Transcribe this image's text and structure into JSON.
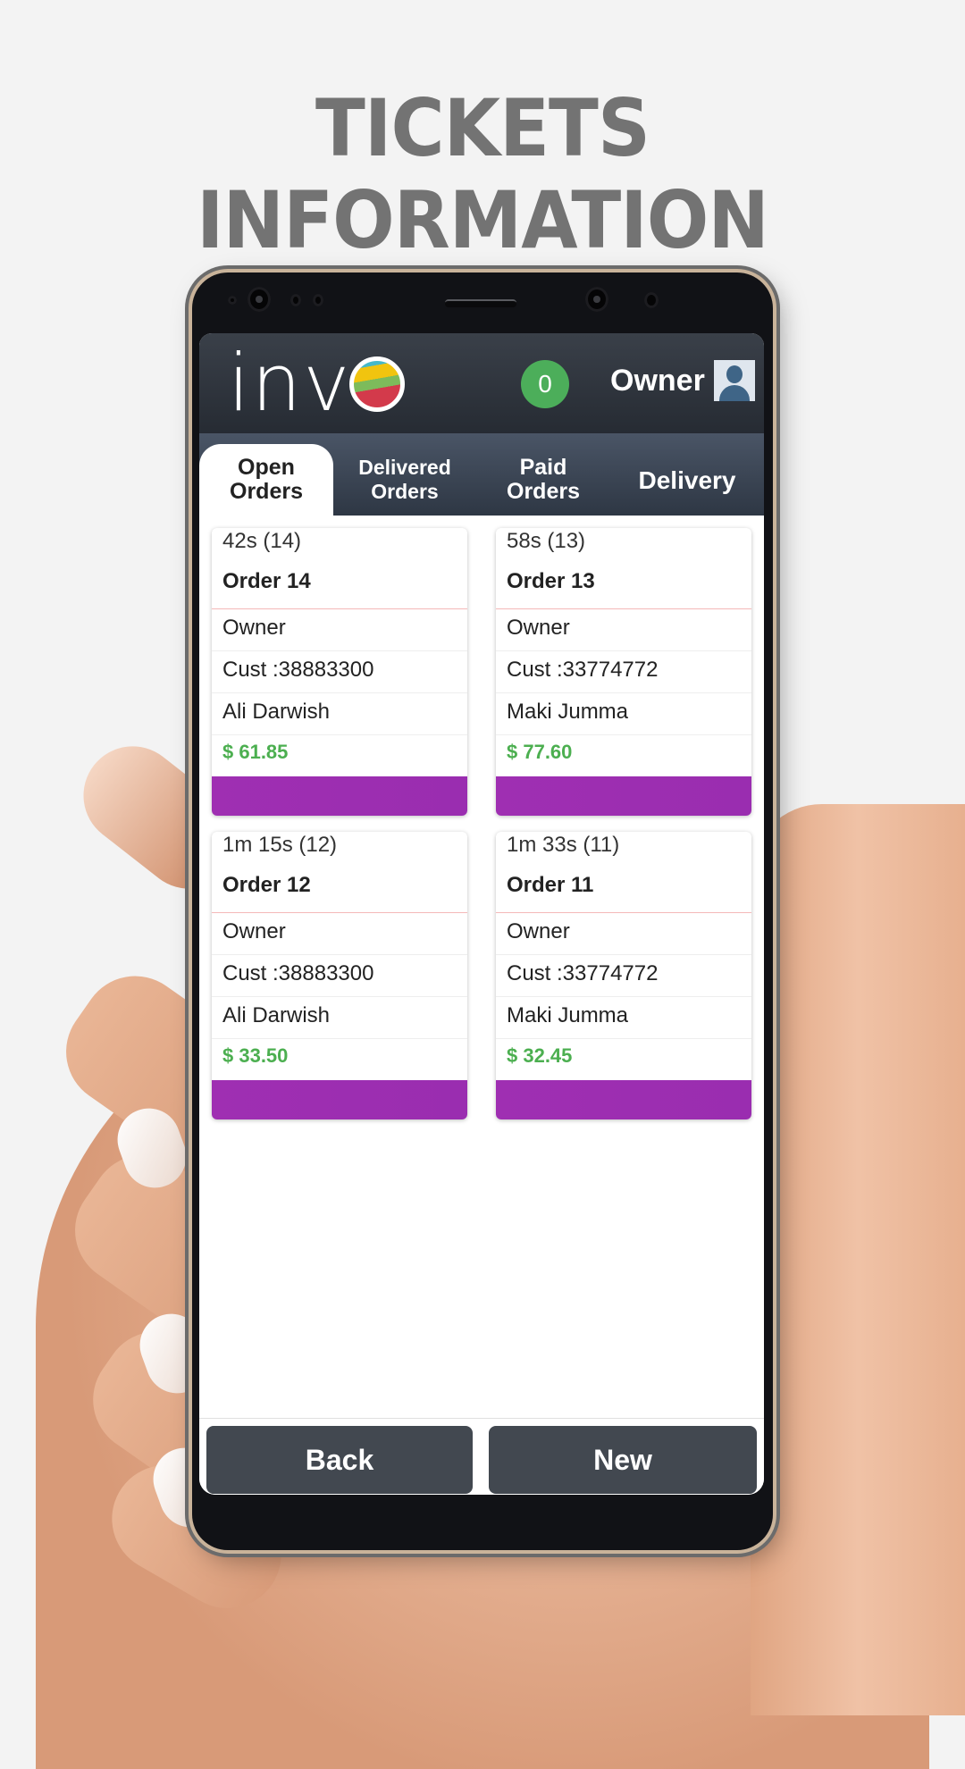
{
  "headline": "TICKETS INFORMATION",
  "app": {
    "logo_text": "inv",
    "notification_count": "0",
    "user_name": "Owner",
    "colors": {
      "accent_green": "#4caf50",
      "card_bar_purple": "#9c27b0",
      "header_dark": "#2f353e"
    }
  },
  "tabs": [
    {
      "label": "Open\nOrders",
      "active": true
    },
    {
      "label": "Delivered\nOrders",
      "active": false
    },
    {
      "label": "Paid\nOrders",
      "active": false
    },
    {
      "label": "Delivery",
      "active": false
    }
  ],
  "orders": [
    {
      "elapsed": "42s (14)",
      "title": "Order 14",
      "employee": "Owner",
      "customer_phone": "Cust :38883300",
      "customer_name": "Ali Darwish",
      "total": "$ 61.85"
    },
    {
      "elapsed": "58s (13)",
      "title": "Order 13",
      "employee": "Owner",
      "customer_phone": "Cust :33774772",
      "customer_name": "Maki Jumma",
      "total": "$ 77.60"
    },
    {
      "elapsed": "1m 15s (12)",
      "title": "Order 12",
      "employee": "Owner",
      "customer_phone": "Cust :38883300",
      "customer_name": "Ali Darwish",
      "total": "$ 33.50"
    },
    {
      "elapsed": "1m 33s (11)",
      "title": "Order 11",
      "employee": "Owner",
      "customer_phone": "Cust :33774772",
      "customer_name": "Maki Jumma",
      "total": "$ 32.45"
    }
  ],
  "footer": {
    "back_label": "Back",
    "new_label": "New"
  }
}
